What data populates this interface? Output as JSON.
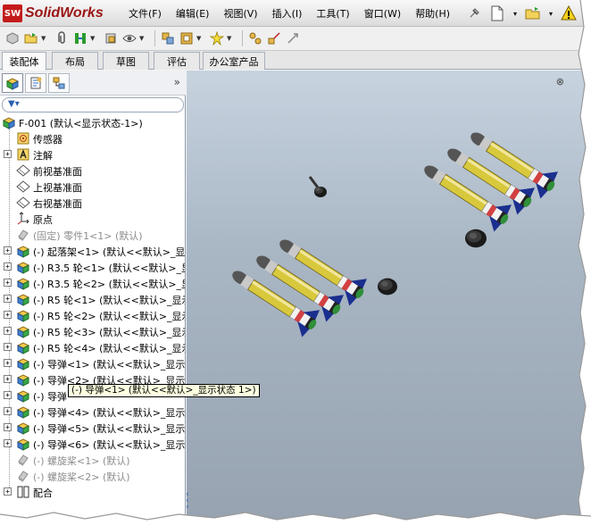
{
  "app": {
    "logo_badge": "SW",
    "logo_text": "SolidWorks"
  },
  "menu": [
    {
      "label": "文件(F)"
    },
    {
      "label": "编辑(E)"
    },
    {
      "label": "视图(V)"
    },
    {
      "label": "插入(I)"
    },
    {
      "label": "工具(T)"
    },
    {
      "label": "窗口(W)"
    },
    {
      "label": "帮助(H)"
    }
  ],
  "tabs": [
    {
      "label": "装配体",
      "active": true
    },
    {
      "label": "布局"
    },
    {
      "label": "草图"
    },
    {
      "label": "评估"
    },
    {
      "label": "办公室产品"
    }
  ],
  "tree": {
    "root": "F-001 (默认<显示状态-1>)",
    "items": [
      {
        "label": "传感器",
        "icon": "sensor-icon"
      },
      {
        "label": "注解",
        "icon": "annotation-icon",
        "expandable": true
      },
      {
        "label": "前视基准面",
        "icon": "plane-icon"
      },
      {
        "label": "上视基准面",
        "icon": "plane-icon"
      },
      {
        "label": "右视基准面",
        "icon": "plane-icon"
      },
      {
        "label": "原点",
        "icon": "origin-icon"
      },
      {
        "label": "(固定) 零件1<1> (默认)",
        "icon": "part-icon",
        "dim": true
      },
      {
        "label": "(-) 起落架<1> (默认<<默认>_显",
        "icon": "subassembly-icon",
        "expandable": true
      },
      {
        "label": "(-) R3.5 轮<1> (默认<<默认>_显",
        "icon": "subassembly-icon",
        "expandable": true
      },
      {
        "label": "(-) R3.5 轮<2> (默认<<默认>_显",
        "icon": "subassembly-icon",
        "expandable": true
      },
      {
        "label": "(-) R5 轮<1> (默认<<默认>_显示",
        "icon": "subassembly-icon",
        "expandable": true
      },
      {
        "label": "(-) R5 轮<2> (默认<<默认>_显示",
        "icon": "subassembly-icon",
        "expandable": true
      },
      {
        "label": "(-) R5 轮<3> (默认<<默认>_显示",
        "icon": "subassembly-icon",
        "expandable": true
      },
      {
        "label": "(-) R5 轮<4> (默认<<默认>_显示",
        "icon": "subassembly-icon",
        "expandable": true
      },
      {
        "label": "(-) 导弹<1> (默认<<默认>_显示",
        "icon": "subassembly-icon",
        "expandable": true
      },
      {
        "label": "(-) 导弹<2> (默认<<默认>_显示",
        "icon": "subassembly-icon",
        "expandable": true
      },
      {
        "label": "(-) 导弹",
        "icon": "subassembly-icon",
        "expandable": true
      },
      {
        "label": "(-) 导弹<4> (默认<<默认>_显示",
        "icon": "subassembly-icon",
        "expandable": true
      },
      {
        "label": "(-) 导弹<5> (默认<<默认>_显示",
        "icon": "subassembly-icon",
        "expandable": true
      },
      {
        "label": "(-) 导弹<6> (默认<<默认>_显示",
        "icon": "subassembly-icon",
        "expandable": true
      },
      {
        "label": "(-) 螺旋桨<1> (默认)",
        "icon": "part-icon",
        "dim": true
      },
      {
        "label": "(-) 螺旋桨<2> (默认)",
        "icon": "part-icon",
        "dim": true
      },
      {
        "label": "配合",
        "icon": "mates-icon",
        "expandable": true
      }
    ]
  },
  "tooltip": "(-) 导弹<1> (默认<<默认>_显示状态 1>)",
  "colors": {
    "viewport_top": "#c7d3df",
    "viewport_bottom": "#97a3b1",
    "missile_body": "#d8c83c",
    "missile_nose": "#555555",
    "missile_fin": "#1a2f8e"
  }
}
